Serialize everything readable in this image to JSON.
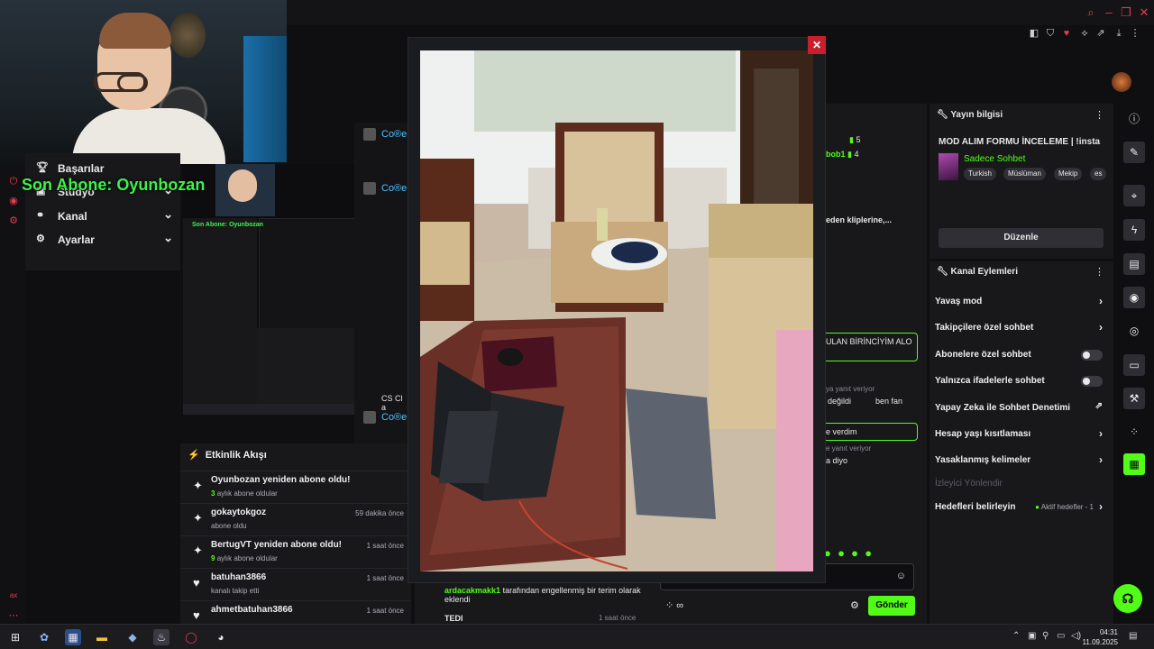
{
  "overlay": {
    "last_sub": "Son Abone: Oyunbozan"
  },
  "nav": {
    "items": [
      {
        "label": "Başarılar",
        "has_chevron": false
      },
      {
        "label": "Stüdyo",
        "has_chevron": true
      },
      {
        "label": "Kanal",
        "has_chevron": true
      },
      {
        "label": "Ayarlar",
        "has_chevron": true
      }
    ]
  },
  "activity": {
    "title": "Etkinlik Akışı",
    "items": [
      {
        "name": "Oyunbozan yeniden abone oldu!",
        "count": "3",
        "sub": "aylık abone oldular",
        "time": "",
        "icon": "sparkle"
      },
      {
        "name": "gokaytokgoz",
        "count": "",
        "sub": "abone oldu",
        "time": "59 dakika önce",
        "icon": "sparkle"
      },
      {
        "name": "BertugVT yeniden abone oldu!",
        "count": "9",
        "sub": "aylık abone oldular",
        "time": "1 saat önce",
        "icon": "sparkle"
      },
      {
        "name": "batuhan3866",
        "count": "",
        "sub": "kanalı takip etti",
        "time": "1 saat önce",
        "icon": "heart"
      },
      {
        "name": "ahmetbatuhan3866",
        "count": "",
        "sub": "",
        "time": "1 saat önce",
        "icon": "heart"
      }
    ]
  },
  "chat_column": {
    "users": [
      "Co®e",
      "Co®e",
      "Co®e"
    ],
    "snippet": "CS Cl a"
  },
  "center_chat": {
    "count_a": "5",
    "user_b": "bob1",
    "count_b": "4",
    "clip_text": "eden kliplerine,...",
    "highlight_1": "ULAN BİRİNCİYİM ALO",
    "reply_1": "ya yanıt veriyor",
    "msg_1a": "değildi",
    "msg_1b": "ben fan",
    "highlight_2": "e verdim",
    "reply_2": "e yanıt veriyor",
    "msg_2": "a diyo",
    "blocked_user": "ardacakmakk1",
    "blocked_text": "tarafından engellenmiş bir terim olarak",
    "blocked_text2": "eklendi",
    "send_label": "Gönder",
    "footer_partial": "TEDI",
    "footer_time": "1 saat önce"
  },
  "stream_info": {
    "header": "Yayın bilgisi",
    "title": "MOD ALIM FORMU İNCELEME | !insta",
    "category": "Sadece Sohbet",
    "tags": [
      "Turkish",
      "Müslüman",
      "Mekip",
      "es"
    ],
    "edit_label": "Düzenle"
  },
  "channel_actions": {
    "header": "Kanal Eylemleri",
    "items": [
      {
        "label": "Yavaş mod",
        "control": "chevron"
      },
      {
        "label": "Takipçilere özel sohbet",
        "control": "chevron"
      },
      {
        "label": "Abonelere özel sohbet",
        "control": "toggle"
      },
      {
        "label": "Yalnızca ifadelerle sohbet",
        "control": "toggle"
      },
      {
        "label": "Yapay Zeka ile Sohbet Denetimi",
        "control": "external"
      },
      {
        "label": "Hesap yaşı kısıtlaması",
        "control": "chevron"
      },
      {
        "label": "Yasaklanmış kelimeler",
        "control": "chevron"
      },
      {
        "label": "İzleyici Yönlendir",
        "control": "none",
        "dim": true
      },
      {
        "label": "Hedefleri belirleyin",
        "control": "chevron",
        "sub": "Aktif hedefler - 1"
      }
    ]
  },
  "taskbar": {
    "time": "04:31",
    "date": "11.09.2025"
  },
  "colors": {
    "accent": "#53fc18",
    "danger": "#c91f2d",
    "overlay_green": "#3ff24a"
  }
}
